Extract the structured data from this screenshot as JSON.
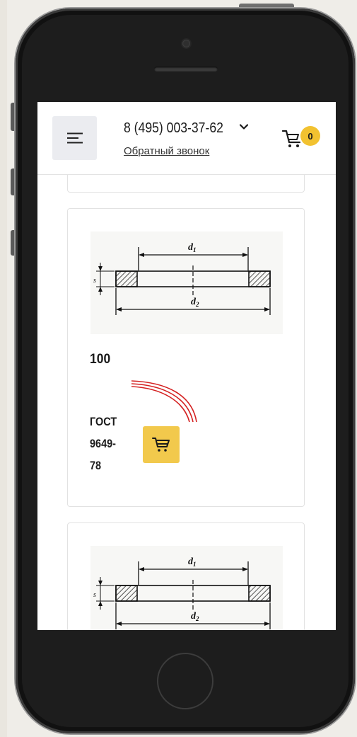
{
  "header": {
    "phone": "8 (495) 003-37-62",
    "callback_label": "Обратный звонок",
    "cart_count": "0"
  },
  "products": [
    {
      "price": "100",
      "name": "ГОСТ 9649-78"
    }
  ],
  "drawing_labels": {
    "d1": "d",
    "d1_sub": "1",
    "d2": "d",
    "d2_sub": "2",
    "s": "s"
  },
  "colors": {
    "accent": "#f2c94c",
    "badge": "#f2c230",
    "phone_body": "#1d1d1d"
  },
  "icons": {
    "menu": "hamburger-icon",
    "dropdown": "chevron-down-icon",
    "cart": "cart-icon"
  }
}
